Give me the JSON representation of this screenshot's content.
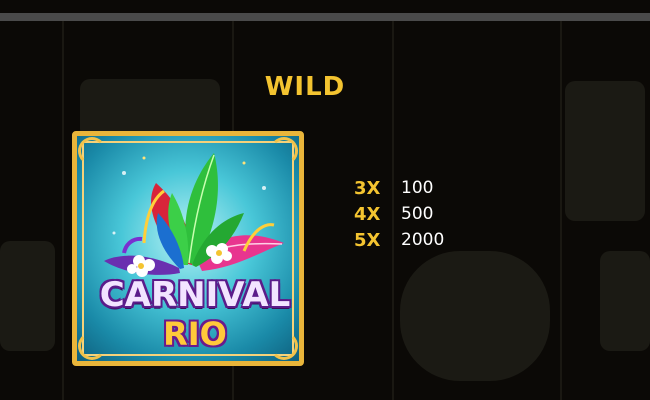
{
  "symbol": {
    "title": "WILD",
    "logo_line1": "CARNIVAL",
    "logo_line2": "RIO",
    "icon": "carnival-feathers-icon"
  },
  "paytable": [
    {
      "multiplier": "3X",
      "payout": "100"
    },
    {
      "multiplier": "4X",
      "payout": "500"
    },
    {
      "multiplier": "5X",
      "payout": "2000"
    }
  ],
  "colors": {
    "title": "#f4c430",
    "frame": "#e9b53a",
    "background": "#0b0906"
  }
}
